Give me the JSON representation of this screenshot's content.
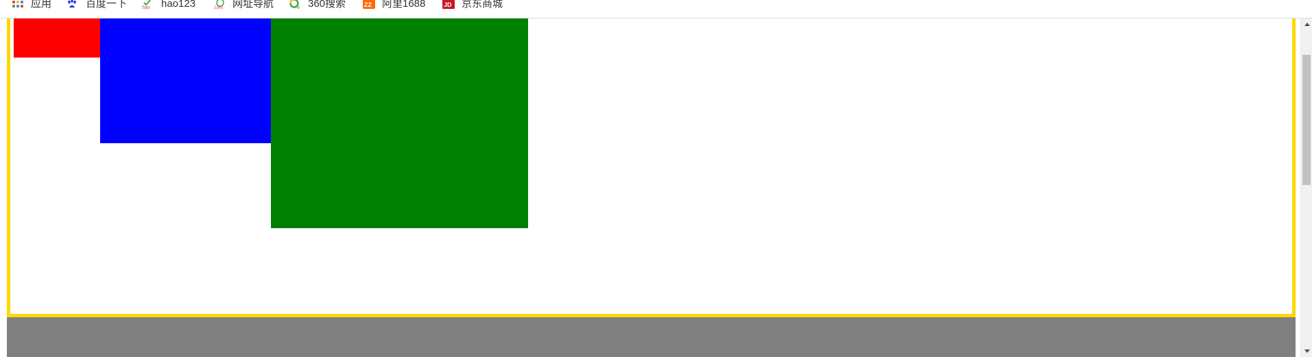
{
  "bookmarks": {
    "items": [
      {
        "label": "应用",
        "icon": "apps-grid-icon"
      },
      {
        "label": "百度一下",
        "icon": "baidu-paw-icon"
      },
      {
        "label": "hao123",
        "icon": "hao123-icon"
      },
      {
        "label": "网址导航",
        "icon": "2345-nav-icon"
      },
      {
        "label": "360搜索",
        "icon": "360-search-icon"
      },
      {
        "label": "阿里1688",
        "icon": "alibaba-1688-icon"
      },
      {
        "label": "京东商城",
        "icon": "jd-icon"
      }
    ]
  },
  "page": {
    "body_background": "#808080",
    "container_border_color": "#ffd700",
    "boxes": [
      {
        "name": "red",
        "color": "#ff0000"
      },
      {
        "name": "blue",
        "color": "#0000ff"
      },
      {
        "name": "green",
        "color": "#008000"
      }
    ]
  }
}
